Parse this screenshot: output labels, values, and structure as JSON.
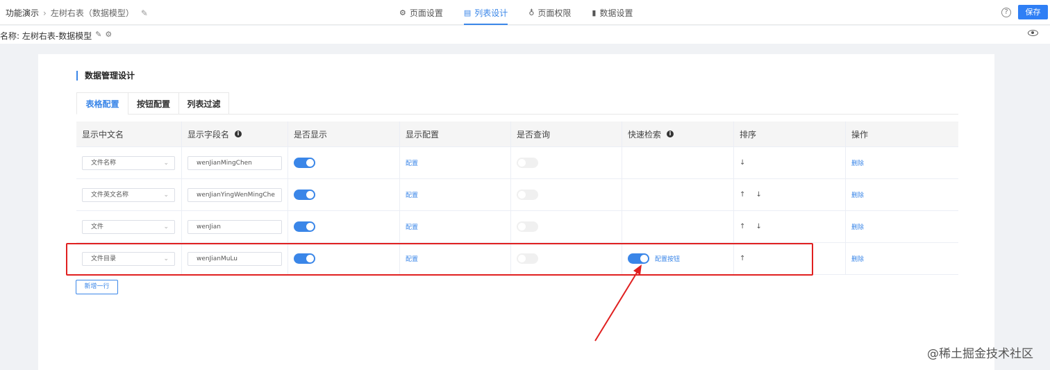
{
  "breadcrumb": {
    "root": "功能演示",
    "current": "左树右表（数据模型）"
  },
  "nav_tabs": [
    {
      "label": "页面设置",
      "icon": "gear-icon"
    },
    {
      "label": "列表设计",
      "icon": "list-icon",
      "active": true
    },
    {
      "label": "页面权限",
      "icon": "key-icon"
    },
    {
      "label": "数据设置",
      "icon": "bar-chart-icon"
    }
  ],
  "help": "?",
  "save_label": "保存",
  "model_name": "名称: 左树右表-数据模型",
  "section_title": "数据管理设计",
  "sub_tabs": [
    "表格配置",
    "按钮配置",
    "列表过滤"
  ],
  "columns": [
    "显示中文名",
    "显示字段名",
    "是否显示",
    "显示配置",
    "是否查询",
    "快速检索",
    "排序",
    "操作"
  ],
  "rows": [
    {
      "name": "文件名称",
      "field": "wenJianMingChen",
      "show": true,
      "config": "配置",
      "query": false,
      "quick": "",
      "sort": "↓",
      "action": "删除"
    },
    {
      "name": "文件英文名称",
      "field": "wenJianYingWenMingChe",
      "show": true,
      "config": "配置",
      "query": false,
      "quick": "",
      "sort": "↑ ↓",
      "action": "删除"
    },
    {
      "name": "文件",
      "field": "wenJian",
      "show": true,
      "config": "配置",
      "query": false,
      "quick": "",
      "sort": "↑ ↓",
      "action": "删除"
    },
    {
      "name": "文件目录",
      "field": "wenJianMuLu",
      "show": true,
      "config": "配置",
      "query": false,
      "quick": "配置按钮",
      "quick_on": true,
      "sort": "↑",
      "action": "删除"
    }
  ],
  "add_row_label": "新增一行",
  "watermark": "@稀土掘金技术社区",
  "colors": {
    "accent": "#3a86e8",
    "highlight": "#e02020"
  }
}
